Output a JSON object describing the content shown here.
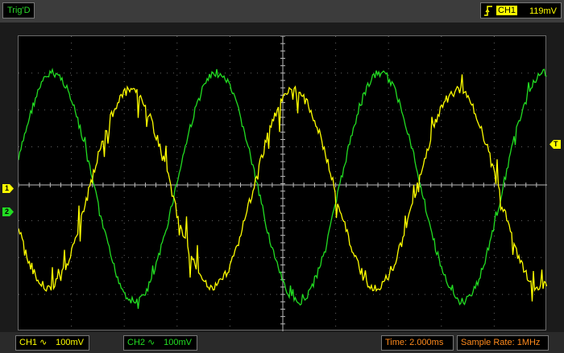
{
  "status": {
    "trigger_state": "Trig'D",
    "trigger_source": "CH1",
    "trigger_level": "119mV",
    "trigger_edge_icon": "rising-edge-icon"
  },
  "markers": {
    "ch1": "1",
    "ch2": "2",
    "trigger": "T"
  },
  "channels": {
    "ch1": {
      "label": "CH1",
      "coupling_symbol": "∿",
      "scale": "100mV",
      "color": "#ffff00"
    },
    "ch2": {
      "label": "CH2",
      "coupling_symbol": "∿",
      "scale": "100mV",
      "color": "#22dd22"
    }
  },
  "timebase": {
    "time": "Time: 2.000ms",
    "sample_rate": "Sample Rate: 1MHz"
  },
  "colors": {
    "grid": "#bbbbbb",
    "grid_dots": "#666666",
    "time_color": "#ff8a1c"
  }
}
